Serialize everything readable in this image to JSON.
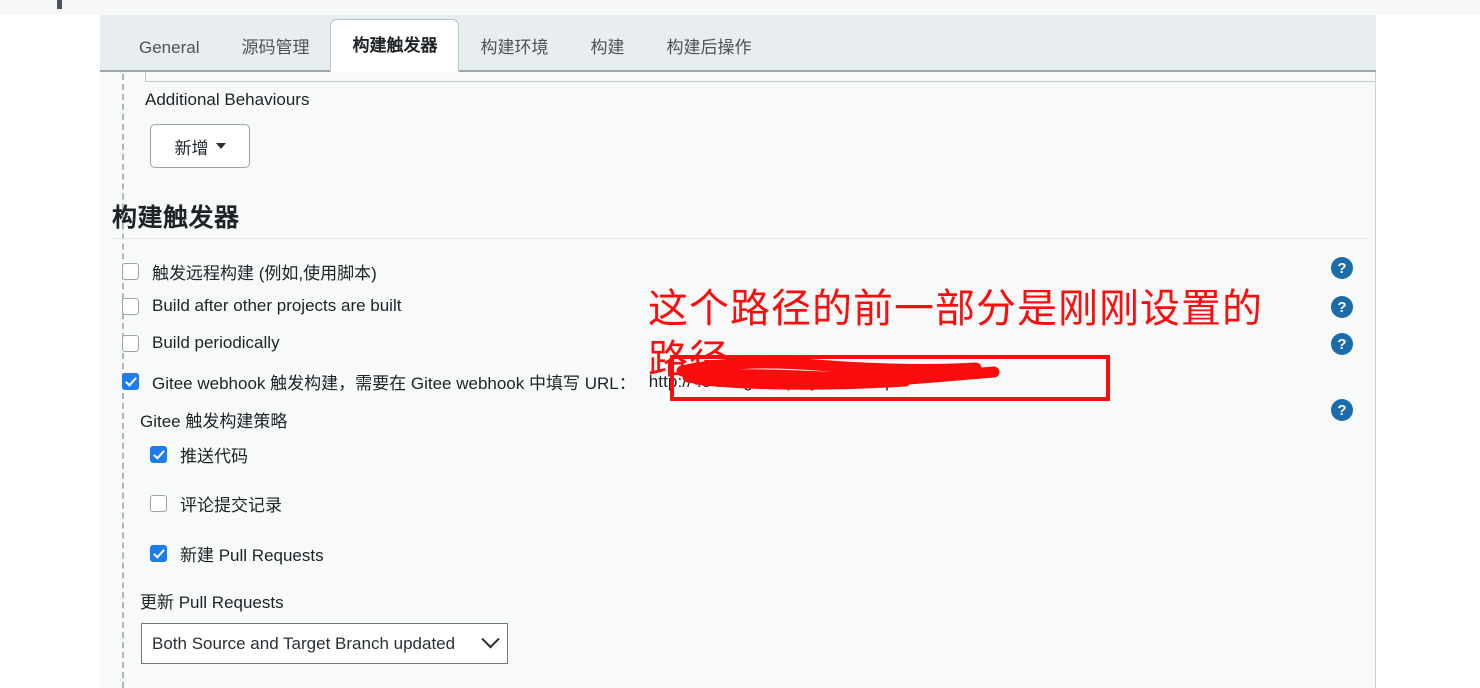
{
  "window": {
    "background_color": "#ffffff",
    "panel_color": "#f8f9f9",
    "tabbar_color": "#e8edef",
    "accent_color": "#1d7ded",
    "help_icon_color": "#1b6ca8",
    "annotation_color": "#fb0d0d"
  },
  "tabs": [
    {
      "label": "General",
      "active": false
    },
    {
      "label": "源码管理",
      "active": false
    },
    {
      "label": "构建触发器",
      "active": true
    },
    {
      "label": "构建环境",
      "active": false
    },
    {
      "label": "构建",
      "active": false
    },
    {
      "label": "构建后操作",
      "active": false
    }
  ],
  "additional_behaviours": {
    "title": "Additional Behaviours",
    "add_button_label": "新增",
    "add_button_caret": "caret-down-icon"
  },
  "build_triggers": {
    "heading": "构建触发器",
    "options": [
      {
        "label": "触发远程构建 (例如,使用脚本)",
        "checked": false,
        "help": "?"
      },
      {
        "label": "Build after other projects are built",
        "checked": false,
        "help": "?"
      },
      {
        "label": "Build periodically",
        "checked": false,
        "help": "?"
      },
      {
        "label": "Gitee webhook 触发构建，需要在 Gitee webhook 中填写 URL：",
        "checked": true,
        "help": "?"
      }
    ],
    "gitee_url": "http://                    :8411/gitee-project/wdf-api",
    "gitee_url_visible_tail": "8411/gitee-project/wdf-api",
    "strategy": {
      "label": "Gitee 触发构建策略",
      "items": [
        {
          "label": "推送代码",
          "checked": true
        },
        {
          "label": "评论提交记录",
          "checked": false
        },
        {
          "label": "新建 Pull Requests",
          "checked": true
        }
      ],
      "update_label": "更新 Pull Requests",
      "update_select_value": "Both Source and Target Branch updated",
      "update_select_caret": "chevron-down-icon"
    }
  },
  "annotation": {
    "line1": "这个路径的前一部分是刚刚设置的",
    "line2": "路径",
    "text": "这个路径的前一部分是刚刚设置的\n路径",
    "color": "#fb0d0d",
    "has_highlight_box": true,
    "has_redaction_scribble": true
  },
  "help_icons": {
    "glyph": "?",
    "count": 4
  }
}
